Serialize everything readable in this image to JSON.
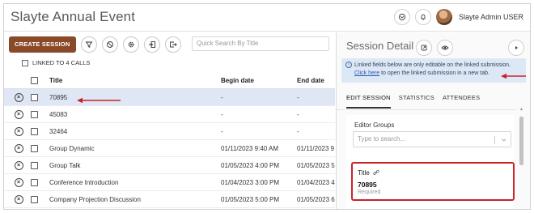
{
  "app": {
    "title": "Slayte Annual Event"
  },
  "header": {
    "user_name": "Slayte Admin USER"
  },
  "toolbar": {
    "create_label": "CREATE SESSION",
    "search_placeholder": "Quick Search By Title"
  },
  "linked": {
    "label": "LINKED TO 4 CALLS"
  },
  "table": {
    "columns": {
      "title": "Title",
      "begin": "Begin date",
      "end": "End date"
    },
    "rows": [
      {
        "title": "70895",
        "begin": "-",
        "end": "-"
      },
      {
        "title": "45083",
        "begin": "-",
        "end": "-"
      },
      {
        "title": "32464",
        "begin": "-",
        "end": "-"
      },
      {
        "title": "Group Dynamic",
        "begin": "01/11/2023 9:40 AM",
        "end": "01/11/2023 9"
      },
      {
        "title": "Group Talk",
        "begin": "01/05/2023 4:00 PM",
        "end": "01/05/2023 5"
      },
      {
        "title": "Conference Introduction",
        "begin": "01/04/2023 3:00 PM",
        "end": "01/04/2023 4"
      },
      {
        "title": "Company Projection Discussion",
        "begin": "01/05/2023 5:00 PM",
        "end": "01/05/2023 6"
      }
    ]
  },
  "detail": {
    "title": "Session Detail",
    "notice_line1": "Linked fields below are only editable on the linked submission.",
    "notice_link": "Click here",
    "notice_rest": " to open the linked submission in a new tab.",
    "tabs": [
      "EDIT SESSION",
      "STATISTICS",
      "ATTENDEES"
    ],
    "editor_groups_label": "Editor Groups",
    "editor_groups_placeholder": "Type to search...",
    "title_field_label": "Title",
    "title_field_value": "70895",
    "title_field_hint": "Required"
  },
  "colors": {
    "brand": "#8a4a28",
    "highlight": "#c8232a",
    "selected_row": "#dfe6f5",
    "notice_bg": "#dde8f6"
  }
}
